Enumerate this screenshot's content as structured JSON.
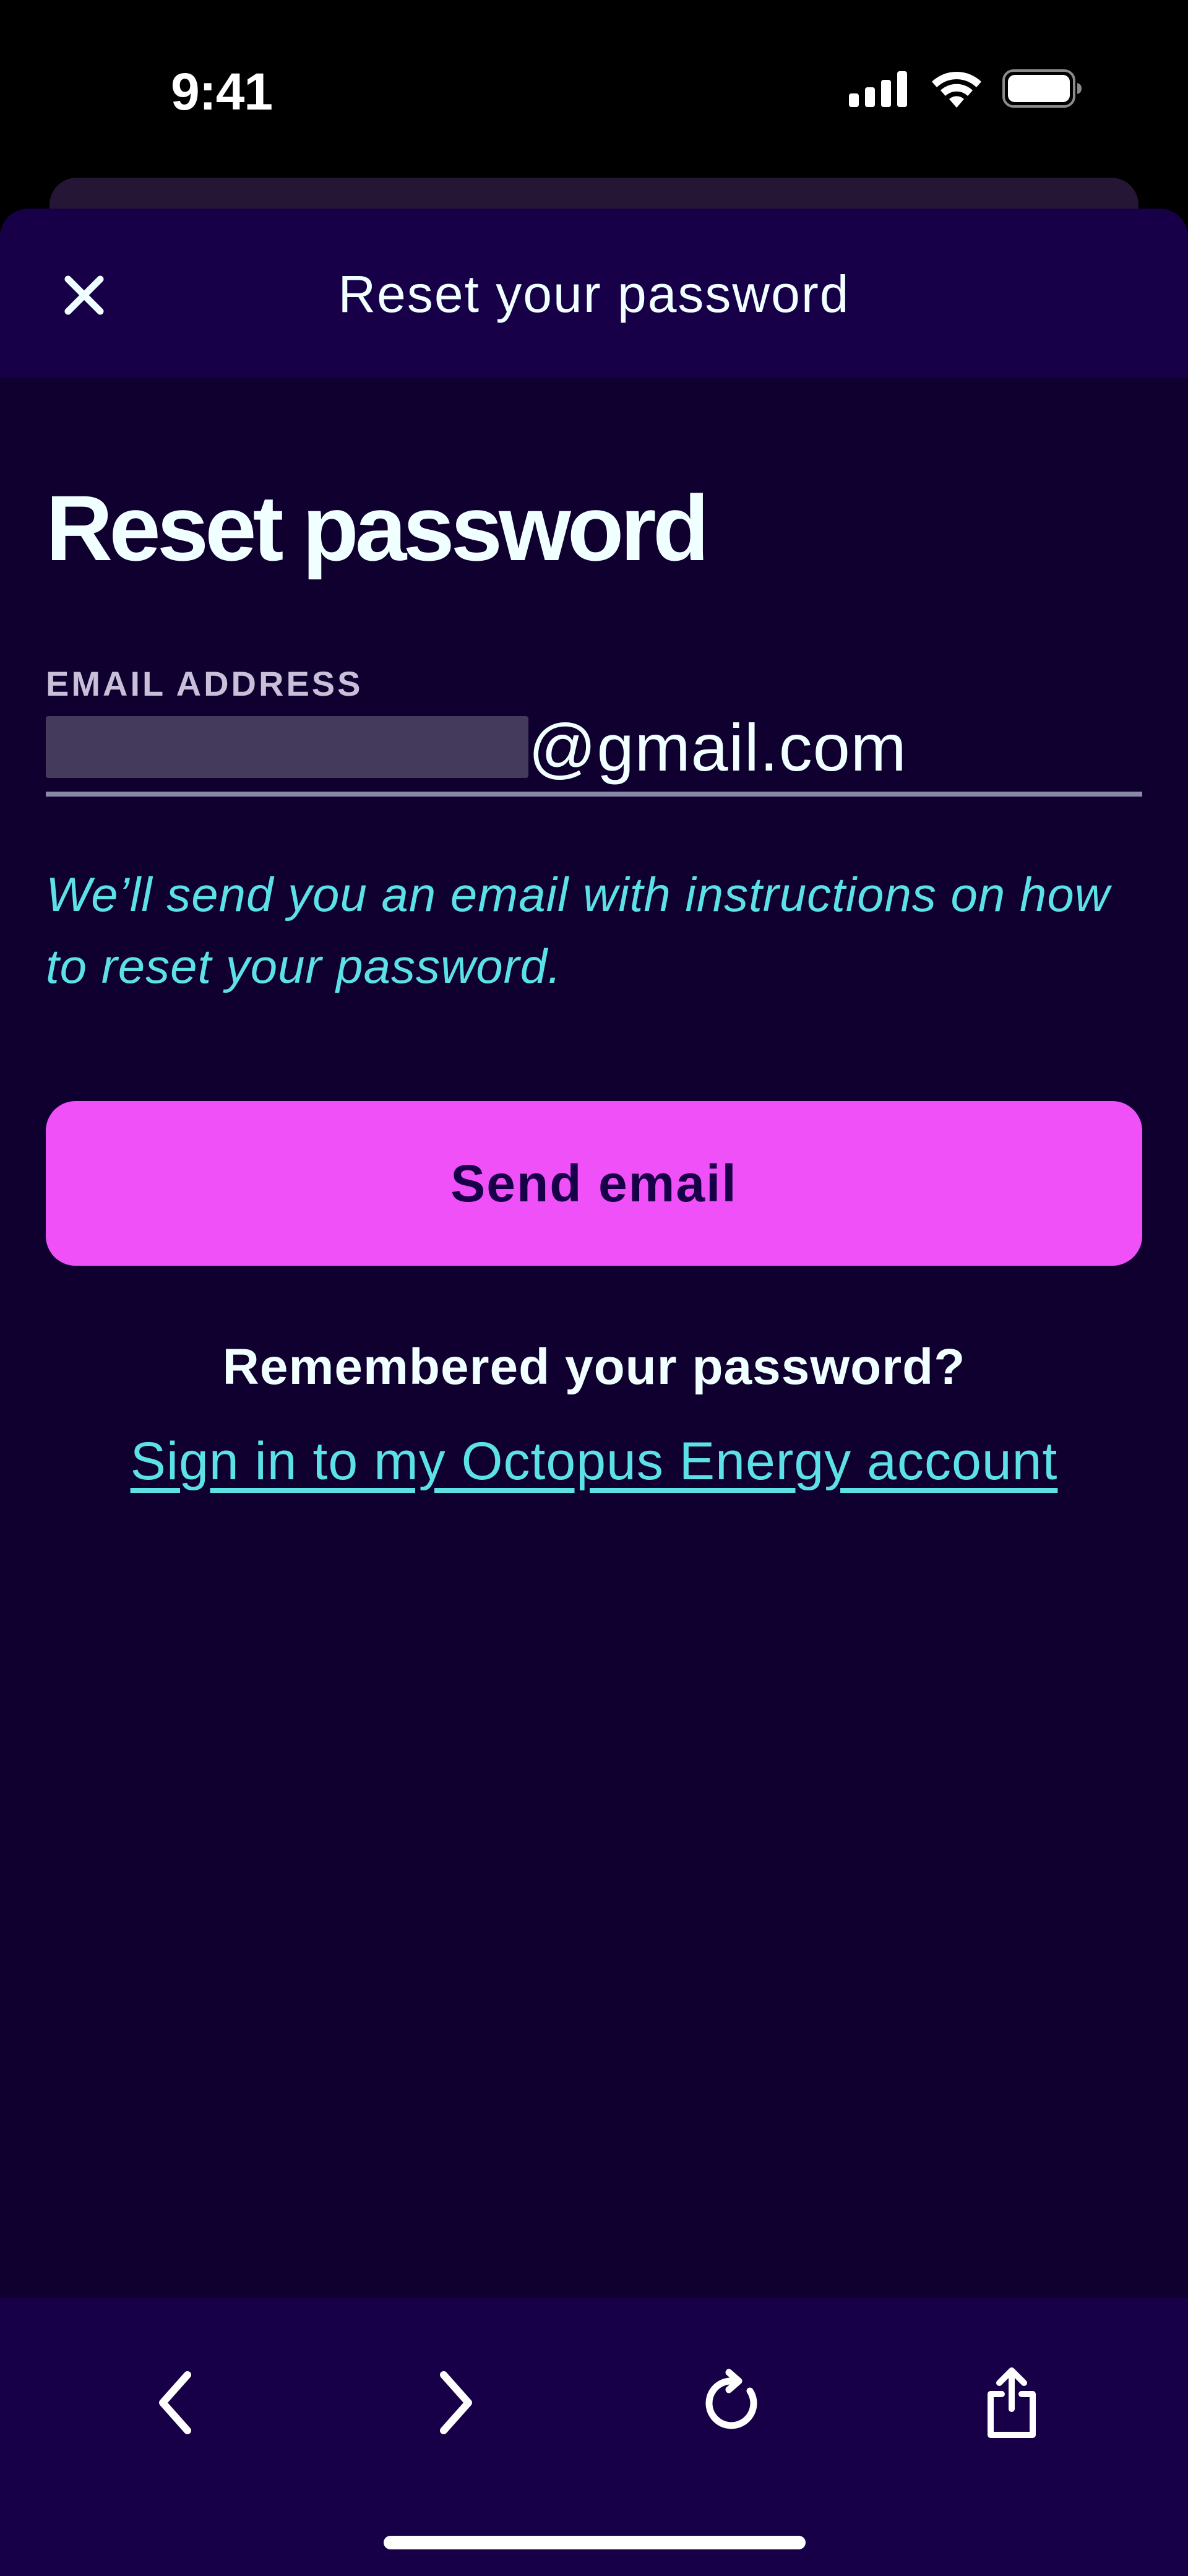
{
  "status_bar": {
    "time": "9:41",
    "icons": [
      "cellular-signal-icon",
      "wifi-icon",
      "battery-icon"
    ]
  },
  "header": {
    "title": "Reset your password",
    "close_icon": "close-icon"
  },
  "page": {
    "heading": "Reset password",
    "email_field": {
      "label": "EMAIL ADDRESS",
      "value_visible": "@gmail.com"
    },
    "help_text": "We’ll send you an email with instructions on how to reset your password.",
    "send_button_label": "Send email",
    "remember_text": "Remembered your password?",
    "signin_link": "Sign in to my Octopus Energy account"
  },
  "browser_toolbar": {
    "icons": [
      "back-icon",
      "forward-icon",
      "reload-icon",
      "share-icon"
    ]
  },
  "colors": {
    "header_bg": "#180048",
    "page_bg": "#100030",
    "accent_pink": "#f050f8",
    "accent_cyan": "#5ce1e6",
    "text_light": "#f0ffff"
  }
}
